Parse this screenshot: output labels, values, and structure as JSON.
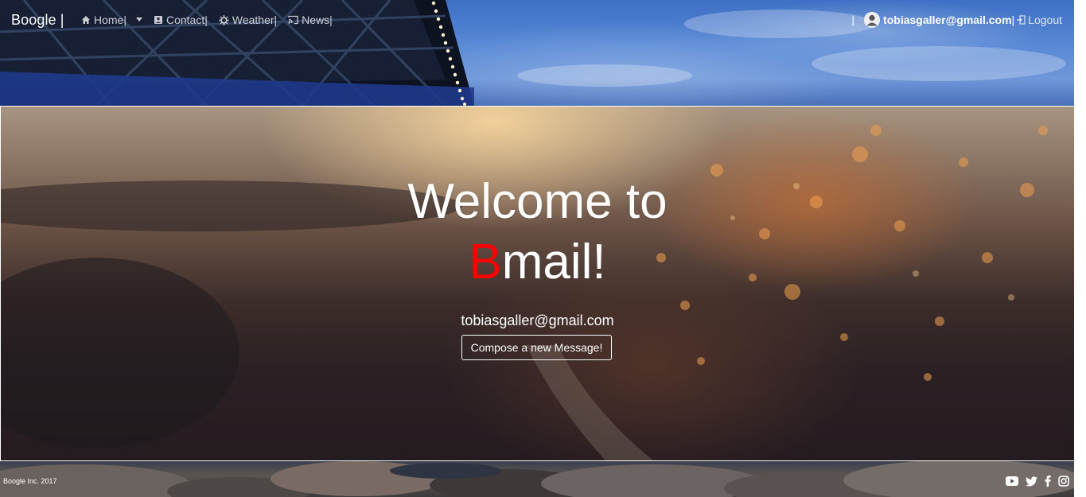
{
  "navbar": {
    "brand": "Boogle |",
    "items": [
      {
        "label": "Home|",
        "icon": "home-icon",
        "dropdown": true
      },
      {
        "label": "Contact|",
        "icon": "contact-card-icon"
      },
      {
        "label": "Weather|",
        "icon": "sun-icon"
      },
      {
        "label": "News|",
        "icon": "cast-icon"
      }
    ],
    "separator": "|",
    "user_email": "tobiasgaller@gmail.com",
    "user_separator": "|",
    "logout": "Logout"
  },
  "hero": {
    "welcome": "Welcome to",
    "brand_initial": "B",
    "brand_rest": "mail!",
    "email": "tobiasgaller@gmail.com",
    "compose_label": "Compose a new Message!"
  },
  "footer": {
    "copyright": "Boogle Inc. 2017",
    "social": [
      "youtube-icon",
      "twitter-icon",
      "facebook-icon",
      "instagram-icon"
    ]
  },
  "colors": {
    "accent_red": "#ff0000",
    "text": "#ffffff"
  }
}
